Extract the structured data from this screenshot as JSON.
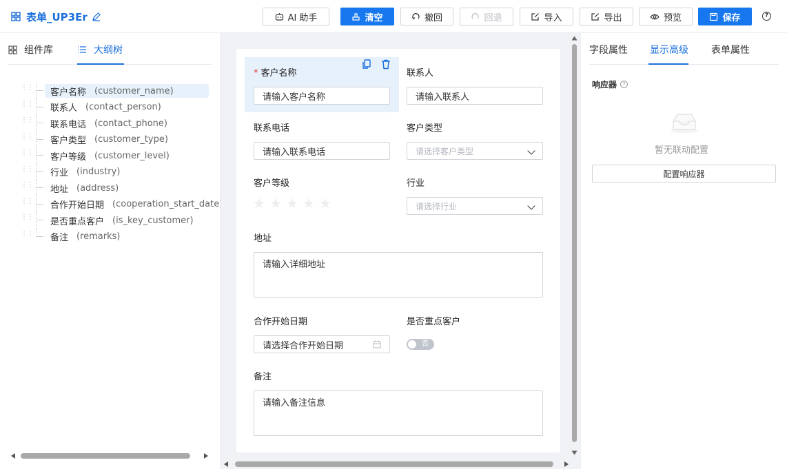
{
  "header": {
    "title": "表单_UP3Er",
    "buttons": {
      "ai": "AI 助手",
      "clear": "清空",
      "undo": "撤回",
      "redo": "回退",
      "import": "导入",
      "export": "导出",
      "preview": "预览",
      "save": "保存"
    }
  },
  "left_panel": {
    "tabs": {
      "components": "组件库",
      "outline": "大纲树"
    },
    "tree": [
      {
        "label": "客户名称",
        "key": "(customer_name)"
      },
      {
        "label": "联系人",
        "key": "(contact_person)"
      },
      {
        "label": "联系电话",
        "key": "(contact_phone)"
      },
      {
        "label": "客户类型",
        "key": "(customer_type)"
      },
      {
        "label": "客户等级",
        "key": "(customer_level)"
      },
      {
        "label": "行业",
        "key": "(industry)"
      },
      {
        "label": "地址",
        "key": "(address)"
      },
      {
        "label": "合作开始日期",
        "key": "(cooperation_start_date)"
      },
      {
        "label": "是否重点客户",
        "key": "(is_key_customer)"
      },
      {
        "label": "备注",
        "key": "(remarks)"
      }
    ]
  },
  "form": {
    "customer_name": {
      "label": "客户名称",
      "placeholder": "请输入客户名称"
    },
    "contact_person": {
      "label": "联系人",
      "placeholder": "请输入联系人"
    },
    "contact_phone": {
      "label": "联系电话",
      "placeholder": "请输入联系电话"
    },
    "customer_type": {
      "label": "客户类型",
      "placeholder": "请选择客户类型"
    },
    "customer_level": {
      "label": "客户等级",
      "rating": 0,
      "max": 5
    },
    "industry": {
      "label": "行业",
      "placeholder": "请选择行业"
    },
    "address": {
      "label": "地址",
      "placeholder": "请输入详细地址"
    },
    "cooperation_start_date": {
      "label": "合作开始日期",
      "placeholder": "请选择合作开始日期"
    },
    "is_key_customer": {
      "label": "是否重点客户",
      "toggle_text": "否"
    },
    "remarks": {
      "label": "备注",
      "placeholder": "请输入备注信息"
    }
  },
  "right_panel": {
    "tabs": {
      "field": "字段属性",
      "display": "显示高级",
      "form": "表单属性"
    },
    "responder_label": "响应器",
    "empty_text": "暂无联动配置",
    "config_button": "配置响应器"
  },
  "colors": {
    "accent": "#1677ee",
    "selected_bg": "#e6f1fc",
    "required": "#e53935"
  }
}
